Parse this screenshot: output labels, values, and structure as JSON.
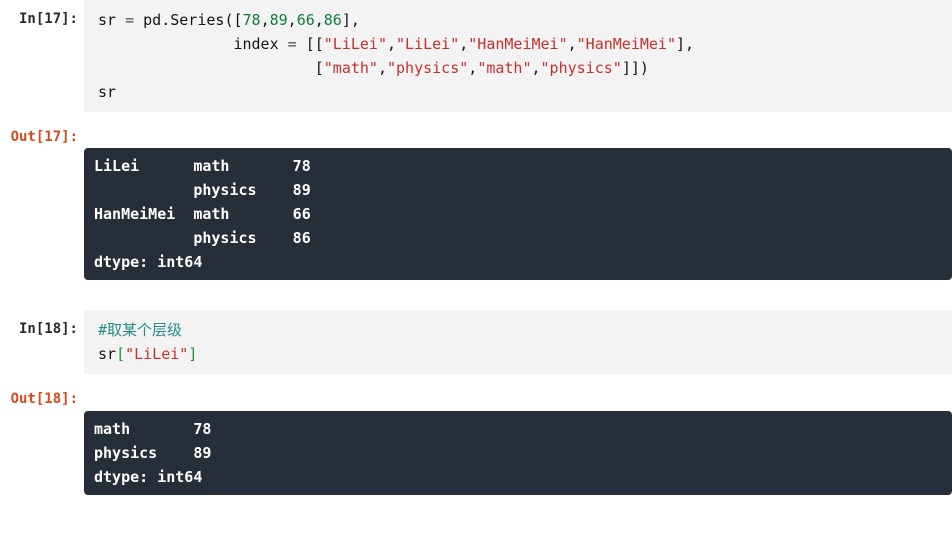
{
  "cells": [
    {
      "in_prompt": "In[17]:",
      "out_prompt": "Out[17]:",
      "code_tokens": [
        [
          {
            "t": "sr ",
            "c": "tok-name"
          },
          {
            "t": "= ",
            "c": "tok-op"
          },
          {
            "t": "pd",
            "c": "tok-name"
          },
          {
            "t": ".",
            "c": "tok-punct"
          },
          {
            "t": "Series",
            "c": "tok-name"
          },
          {
            "t": "([",
            "c": "tok-punct"
          },
          {
            "t": "78",
            "c": "tok-num"
          },
          {
            "t": ",",
            "c": "tok-punct"
          },
          {
            "t": "89",
            "c": "tok-num"
          },
          {
            "t": ",",
            "c": "tok-punct"
          },
          {
            "t": "66",
            "c": "tok-num"
          },
          {
            "t": ",",
            "c": "tok-punct"
          },
          {
            "t": "86",
            "c": "tok-num"
          },
          {
            "t": "],",
            "c": "tok-punct"
          }
        ],
        [
          {
            "t": "               index ",
            "c": "tok-name"
          },
          {
            "t": "= ",
            "c": "tok-op"
          },
          {
            "t": "[[",
            "c": "tok-punct"
          },
          {
            "t": "\"LiLei\"",
            "c": "tok-str"
          },
          {
            "t": ",",
            "c": "tok-punct"
          },
          {
            "t": "\"LiLei\"",
            "c": "tok-str"
          },
          {
            "t": ",",
            "c": "tok-punct"
          },
          {
            "t": "\"HanMeiMei\"",
            "c": "tok-str"
          },
          {
            "t": ",",
            "c": "tok-punct"
          },
          {
            "t": "\"HanMeiMei\"",
            "c": "tok-str"
          },
          {
            "t": "],",
            "c": "tok-punct"
          }
        ],
        [
          {
            "t": "                        [",
            "c": "tok-punct"
          },
          {
            "t": "\"math\"",
            "c": "tok-str"
          },
          {
            "t": ",",
            "c": "tok-punct"
          },
          {
            "t": "\"physics\"",
            "c": "tok-str"
          },
          {
            "t": ",",
            "c": "tok-punct"
          },
          {
            "t": "\"math\"",
            "c": "tok-str"
          },
          {
            "t": ",",
            "c": "tok-punct"
          },
          {
            "t": "\"physics\"",
            "c": "tok-str"
          },
          {
            "t": "]])",
            "c": "tok-punct"
          }
        ],
        [
          {
            "t": "sr",
            "c": "tok-name"
          }
        ]
      ],
      "output_lines": [
        "LiLei      math       78",
        "           physics    89",
        "HanMeiMei  math       66",
        "           physics    86",
        "dtype: int64"
      ]
    },
    {
      "in_prompt": "In[18]:",
      "out_prompt": "Out[18]:",
      "code_tokens": [
        [
          {
            "t": "#取某个层级",
            "c": "tok-comm"
          }
        ],
        [
          {
            "t": "sr",
            "c": "tok-name"
          },
          {
            "t": "[",
            "c": "tok-idx"
          },
          {
            "t": "\"LiLei\"",
            "c": "tok-str"
          },
          {
            "t": "]",
            "c": "tok-idx"
          }
        ]
      ],
      "output_lines": [
        "math       78",
        "physics    89",
        "dtype: int64"
      ]
    }
  ]
}
